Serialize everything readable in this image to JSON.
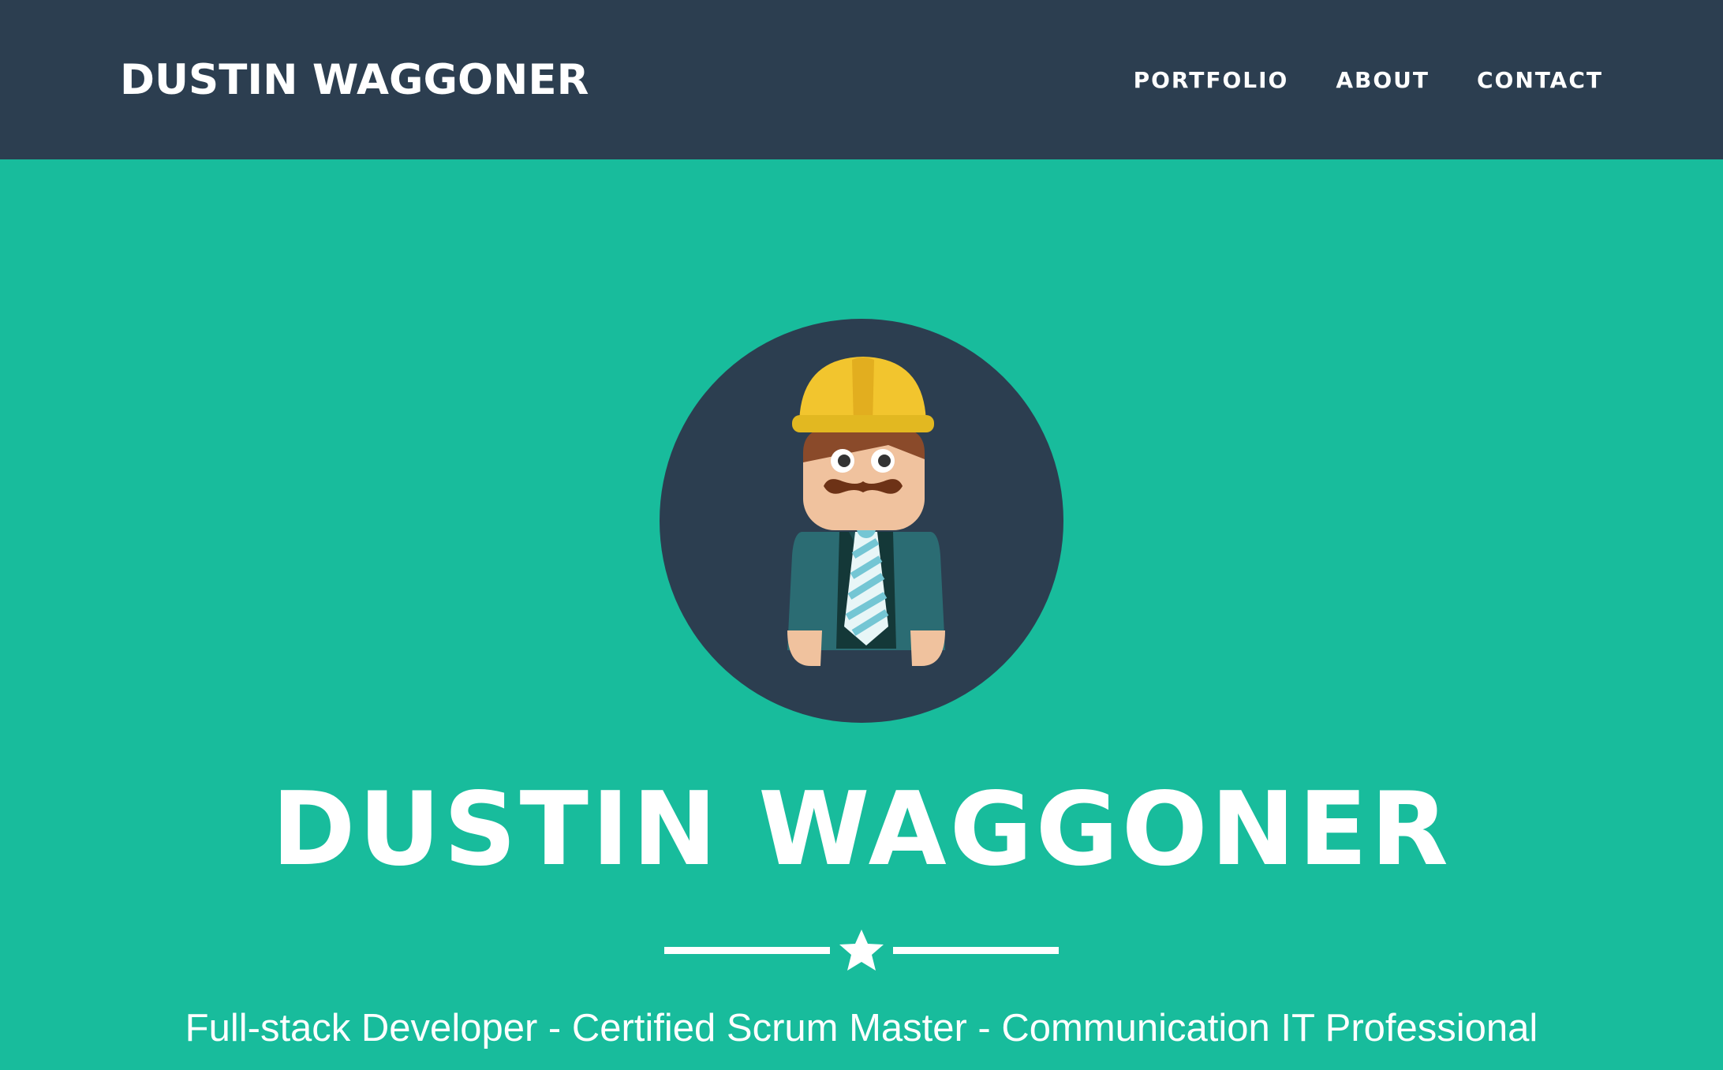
{
  "navbar": {
    "brand": "DUSTIN WAGGONER",
    "links": [
      {
        "label": "PORTFOLIO"
      },
      {
        "label": "ABOUT"
      },
      {
        "label": "CONTACT"
      }
    ]
  },
  "hero": {
    "title": "DUSTIN WAGGONER",
    "subtitle": "Full-stack Developer - Certified Scrum Master - Communication IT Professional",
    "avatar_icon": "construction-worker-avatar-icon",
    "divider_icon": "star-icon"
  },
  "colors": {
    "navbar_bg": "#2c3e50",
    "hero_bg": "#18bc9c",
    "text": "#ffffff"
  }
}
